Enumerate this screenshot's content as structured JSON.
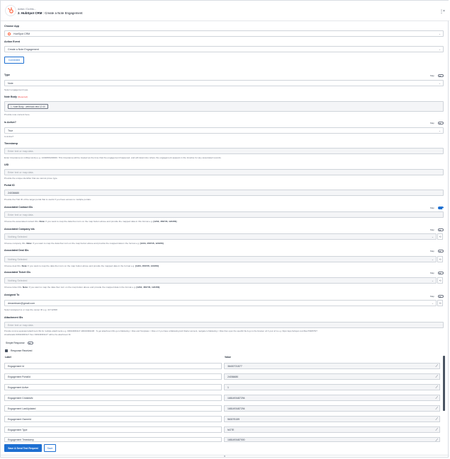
{
  "header": {
    "subtitle": "Action / Do this...",
    "step": "2. HubSpot CRM",
    "title": "Create a Note Engagement",
    "menu_icon": "more-vert-icon",
    "close_icon": "close-icon"
  },
  "choose_app": {
    "label": "Choose App",
    "value": "HubSpot CRM"
  },
  "action_event": {
    "label": "Action Event",
    "value": "Create a Note Engagement"
  },
  "connected_button": "Connected",
  "map_label": "Map",
  "type_field": {
    "label": "Type",
    "value": "Note",
    "help": "Select engagement type."
  },
  "note_body": {
    "label": "Note Body",
    "required": "(Required)",
    "pill": "1. Note Body : webhook test 12:40",
    "help": "Provide note content here."
  },
  "is_active": {
    "label": "Is Active?",
    "value": "True",
    "help": "Is Active?"
  },
  "timestamp": {
    "label": "Timestamp",
    "placeholder": "Enter text or map data.",
    "help": "Enter timestamp (in milliseconds) e.g. 1434896160000. This timestamp will be treated as the time that the engagement happened, and will determine where the engagement appears in the timeline for any associated records."
  },
  "uid": {
    "label": "UID",
    "placeholder": "Enter text or map data.",
    "help": "Provide the unique identifier that we cannot prove type."
  },
  "portal_id": {
    "label": "Portal ID",
    "value": "24036680",
    "help": "Provide the Hub ID of the target portal that is useful if you have access to multiple portals."
  },
  "contact_ids": {
    "label": "Associated Contact IDs",
    "placeholder": "Enter text or map data.",
    "help_pre": "Choose the associated contact IDs.",
    "help_note": "Note:",
    "help_post": "If you want to map the data then turn on the map button above and provide the mapped data in this format e.g.",
    "help_example": "[1234, 456745, 123456]"
  },
  "company_ids": {
    "label": "Associated Company Ids",
    "value": "Nothing Selected",
    "help_pre": "Choose company IDs.",
    "help_note": "Note:",
    "help_post": "If you want to map the data then turn on the map button above and provide the mapped data in the format e.g.",
    "help_example": "[1234, 456745, 123456]"
  },
  "deal_ids": {
    "label": "Associated Deal IDs",
    "value": "Nothing Selected",
    "help_pre": "Choose deal IDs.",
    "help_note": "Note:",
    "help_post": "If you want to map the data then turn on the map button above and provide the mapped data in the format e.g.",
    "help_example": "[1234, 456745, 123456]"
  },
  "ticket_ids": {
    "label": "Associated Ticket IDs",
    "value": "Nothing Selected",
    "help_pre": "Choose ticket IDs.",
    "help_note": "Note:",
    "help_post": "If you want to map the data then turn on the map button above and provide the mapped data in the format e.g.",
    "help_example": "[1234, 456745, 123456]"
  },
  "assigned_to": {
    "label": "Assigned To",
    "value": "dreamteam@gmail.com",
    "help": "Select assigned to or map the owner ID e.g. 41712368"
  },
  "attachment_ids": {
    "label": "Attachment IDs",
    "placeholder": "Enter text or map data.",
    "help": "Provide comma separated attachment IDs for multiple attachments e.g. 496343963127,496343964238 . To get attachment IDs go to Marketing > Files and Templates > Files or if you have a Marketing Hub Starter account, navigate to Marketing > Files then open the specific file & go to the browser url if your url is e.g. https://app.hubspot.com/files/7996575/?",
    "help2": "showDetails=496343963127 then '496343963127' will be the attachment ID."
  },
  "simple_response": "Simple Response",
  "response_received": "Response Received",
  "table": {
    "label_header": "Label",
    "value_header": "Value",
    "rows": [
      {
        "label": "Engagement Id",
        "value": "36400731577"
      },
      {
        "label": "Engagement PortalId",
        "value": "24036680"
      },
      {
        "label": "Engagement Active",
        "value": "1"
      },
      {
        "label": "Engagement CreatedAt",
        "value": "1681493487294"
      },
      {
        "label": "Engagement LastUpdated",
        "value": "1681493487294"
      },
      {
        "label": "Engagement OwnerId",
        "value": "563075159"
      },
      {
        "label": "Engagement Type",
        "value": "NOTE"
      },
      {
        "label": "Engagement Timestamp",
        "value": "1681493487000"
      }
    ]
  },
  "save_send_button": "Save & Send Test Request",
  "save_button": "Save"
}
